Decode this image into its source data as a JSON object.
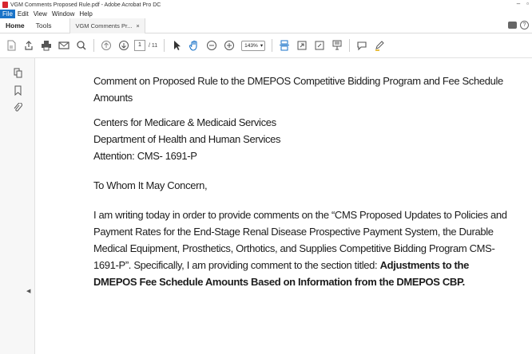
{
  "window": {
    "title": "VGM Comments Proposed Rule.pdf - Adobe Acrobat Pro DC",
    "controls": {
      "minimize": "–",
      "restore": "▫"
    }
  },
  "menu": [
    "File",
    "Edit",
    "View",
    "Window",
    "Help"
  ],
  "tabs": {
    "home": "Home",
    "tools": "Tools",
    "document": "VGM Comments Pr...",
    "close": "×",
    "help": "?"
  },
  "toolbar": {
    "page_current": "1",
    "page_total": "/ 11",
    "zoom": "143%"
  },
  "document": {
    "title_line1": "Comment on Proposed Rule to the DMEPOS Competitive Bidding Program and Fee Schedule",
    "title_line2": "Amounts",
    "address": [
      "Centers for Medicare & Medicaid Services",
      "Department of Health and Human Services",
      "Attention: CMS- 1691-P"
    ],
    "salutation": "To Whom It May Concern,",
    "body_lines": [
      "I am writing today in order to provide comments on the “CMS Proposed Updates to Policies and",
      "Payment Rates for the End-Stage Renal Disease Prospective Payment System, the Durable",
      "Medical Equipment, Prosthetics, Orthotics, and Supplies Competitive Bidding Program CMS-"
    ],
    "body_line4_prefix": "1691-P”. Specifically, I am providing comment to the section titled: ",
    "body_line4_bold": "Adjustments to the",
    "body_line5_bold": "DMEPOS Fee Schedule Amounts Based on Information from the DMEPOS CBP."
  }
}
